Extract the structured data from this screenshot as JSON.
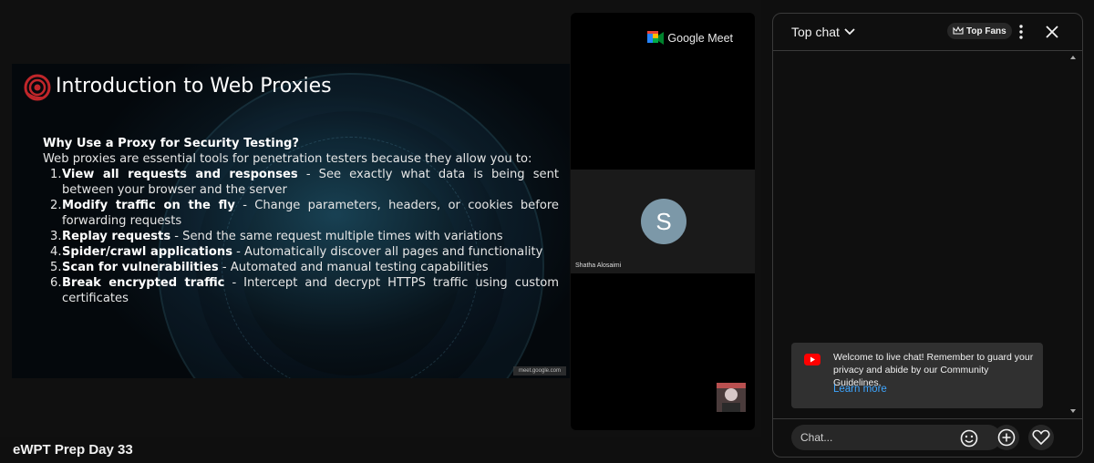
{
  "slide": {
    "title": "Introduction to Web Proxies",
    "heading": "Why Use a Proxy for Security Testing?",
    "intro": "Web proxies are essential tools for penetration testers because they allow you to:",
    "items": [
      {
        "num": "1.",
        "bold": "View all requests and responses",
        "rest": " - See exactly what data is being sent between your browser and the server"
      },
      {
        "num": "2.",
        "bold": "Modify traffic on the fly",
        "rest": " - Change parameters, headers, or cookies before forwarding requests"
      },
      {
        "num": "3.",
        "bold": "Replay requests",
        "rest": " - Send the same request multiple times with variations"
      },
      {
        "num": "4.",
        "bold": "Spider/crawl applications",
        "rest": " - Automatically discover all pages and functionality"
      },
      {
        "num": "5.",
        "bold": "Scan for vulnerabilities",
        "rest": " - Automated and manual testing capabilities"
      },
      {
        "num": "6.",
        "bold": "Break encrypted traffic",
        "rest": " - Intercept and decrypt HTTPS traffic using custom certificates"
      }
    ],
    "url": "meet.google.com"
  },
  "meet": {
    "brand": "Google Meet",
    "participant_initial": "S",
    "participant_name": "Shatha Alosaimi"
  },
  "stream": {
    "title": "eWPT Prep Day 33"
  },
  "chat": {
    "mode_label": "Top chat",
    "top_fans_label": "Top Fans",
    "welcome_text": "Welcome to live chat! Remember to guard your privacy and abide by our Community Guidelines.",
    "learn_more": "Learn more",
    "input_placeholder": "Chat..."
  },
  "colors": {
    "background": "#0f0f0f",
    "link": "#3ea6ff",
    "youtube_red": "#ff0000",
    "avatar": "#7c98a8"
  },
  "icons": [
    "chevron-down-icon",
    "crown-icon",
    "more-vert-icon",
    "close-icon",
    "youtube-icon",
    "emoji-icon",
    "add-circle-icon",
    "heart-icon",
    "scroll-up-icon",
    "scroll-down-icon",
    "google-meet-icon"
  ]
}
